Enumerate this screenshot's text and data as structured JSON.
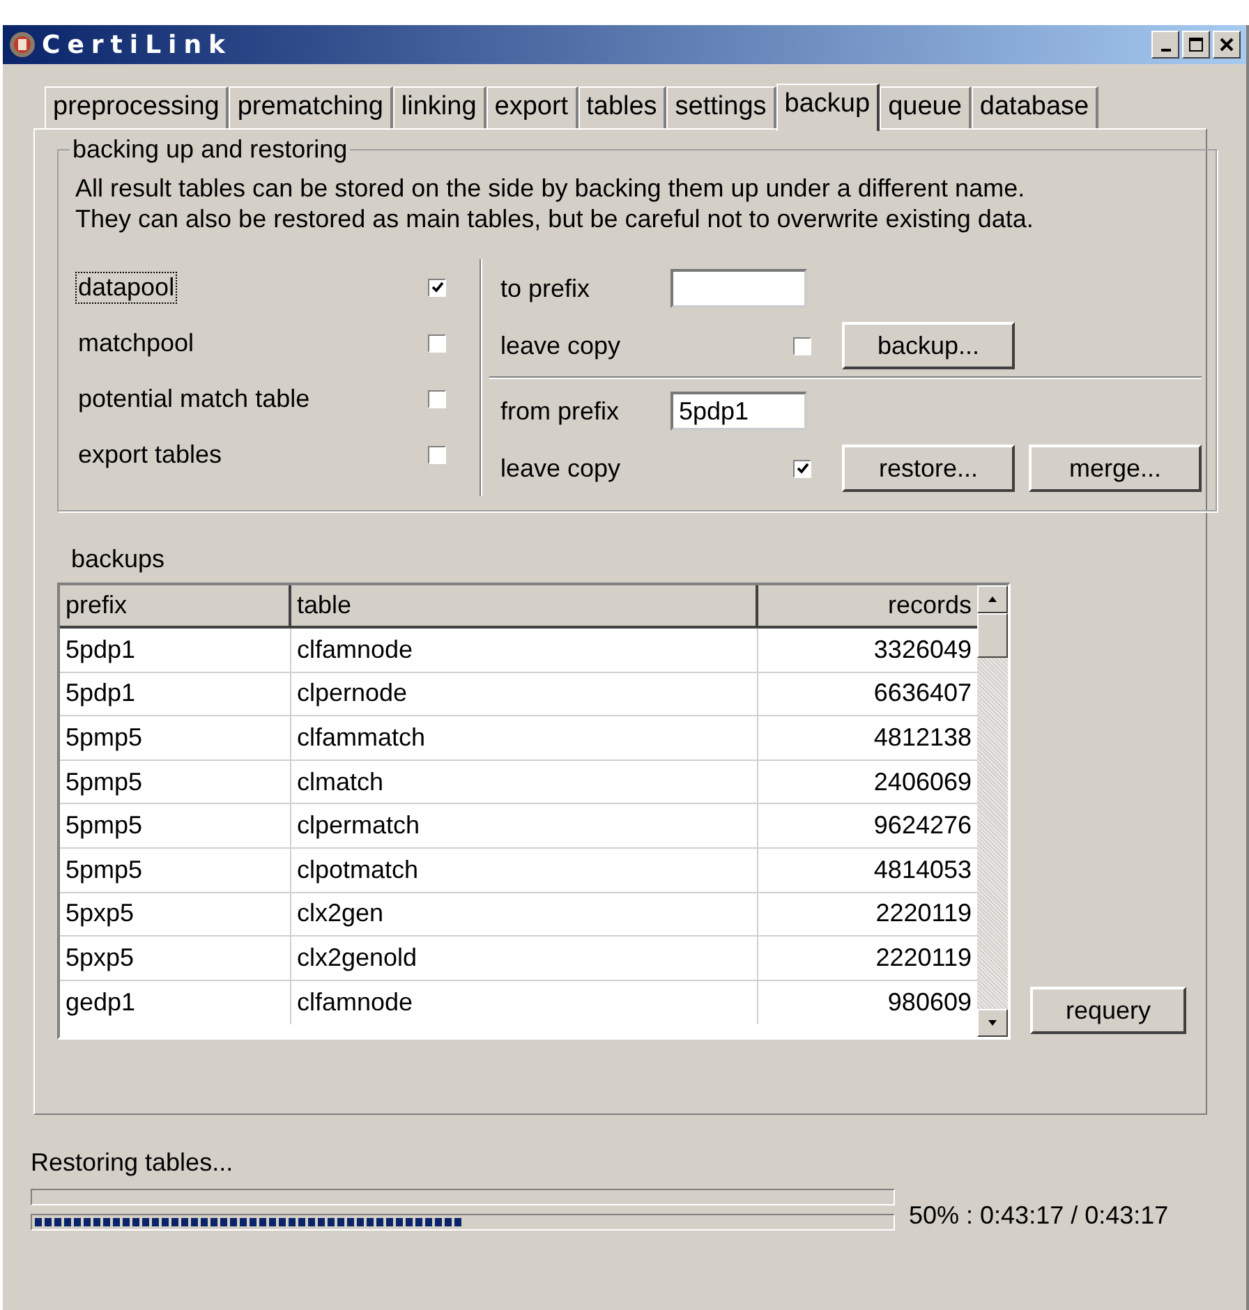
{
  "window": {
    "title": "CertiLink"
  },
  "tabs": [
    {
      "label": "preprocessing",
      "selected": false
    },
    {
      "label": "prematching",
      "selected": false
    },
    {
      "label": "linking",
      "selected": false
    },
    {
      "label": "export",
      "selected": false
    },
    {
      "label": "tables",
      "selected": false
    },
    {
      "label": "settings",
      "selected": false
    },
    {
      "label": "backup",
      "selected": true
    },
    {
      "label": "queue",
      "selected": false
    },
    {
      "label": "database",
      "selected": false
    }
  ],
  "backup_group": {
    "title": "backing up and restoring",
    "description": "All result tables can be stored on the side by backing them up under a different name. They can also be restored as main tables, but be careful not to overwrite existing data.",
    "tables": [
      {
        "label": "datapool",
        "checked": true,
        "focused": true
      },
      {
        "label": "matchpool",
        "checked": false,
        "focused": false
      },
      {
        "label": "potential match table",
        "checked": false,
        "focused": false
      },
      {
        "label": "export tables",
        "checked": false,
        "focused": false
      }
    ],
    "backup": {
      "prefix_label": "to prefix",
      "leave_copy_label": "leave copy",
      "leave_copy": false,
      "buttons": [
        "backup..."
      ]
    },
    "restore": {
      "prefix_label": "from prefix",
      "prefix_value": "5pdp1",
      "leave_copy_label": "leave copy",
      "leave_copy": true,
      "buttons": [
        "restore...",
        "merge..."
      ]
    }
  },
  "backups": {
    "label": "backups",
    "columns": [
      "prefix",
      "table",
      "records"
    ],
    "rows": [
      [
        "5pdp1",
        "clfamnode",
        "3326049"
      ],
      [
        "5pdp1",
        "clpernode",
        "6636407"
      ],
      [
        "5pmp5",
        "clfammatch",
        "4812138"
      ],
      [
        "5pmp5",
        "clmatch",
        "2406069"
      ],
      [
        "5pmp5",
        "clpermatch",
        "9624276"
      ],
      [
        "5pmp5",
        "clpotmatch",
        "4814053"
      ],
      [
        "5pxp5",
        "clx2gen",
        "2220119"
      ],
      [
        "5pxp5",
        "clx2genold",
        "2220119"
      ],
      [
        "gedp1",
        "clfamnode",
        "980609"
      ]
    ],
    "requery_button": "requery"
  },
  "status": {
    "message": "Restoring tables...",
    "progress": {
      "level": 0.5
    },
    "reading": "50% : 0:43:17 / 0:43:17"
  }
}
